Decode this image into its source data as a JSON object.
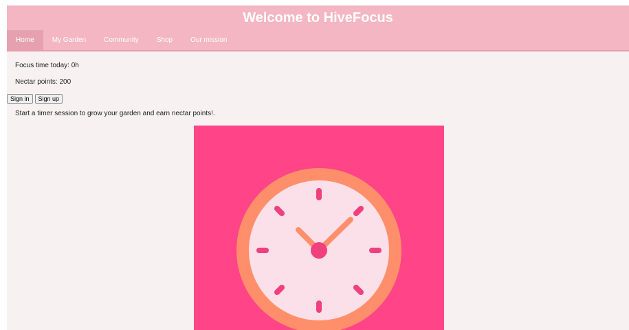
{
  "header": {
    "title": "Welcome to HiveFocus"
  },
  "nav": {
    "items": [
      {
        "label": "Home",
        "active": true
      },
      {
        "label": "My Garden"
      },
      {
        "label": "Community"
      },
      {
        "label": "Shop"
      },
      {
        "label": "Our mission"
      }
    ]
  },
  "stats": {
    "focus_time": "Focus time today: 0h",
    "nectar_points": "Nectar points: 200"
  },
  "auth": {
    "sign_in": "Sign in",
    "sign_up": "Sign up"
  },
  "intro": "Start a timer session to grow your garden and earn nectar points!.",
  "hero": {
    "icon": "clock-icon"
  },
  "colors": {
    "header_bg": "#f3b6c2",
    "page_bg": "#f7f1f1",
    "hero_bg": "#ff4487",
    "clock_ring": "#ff8f6b",
    "clock_face": "#fbe0ea",
    "clock_marks": "#f0407e"
  }
}
